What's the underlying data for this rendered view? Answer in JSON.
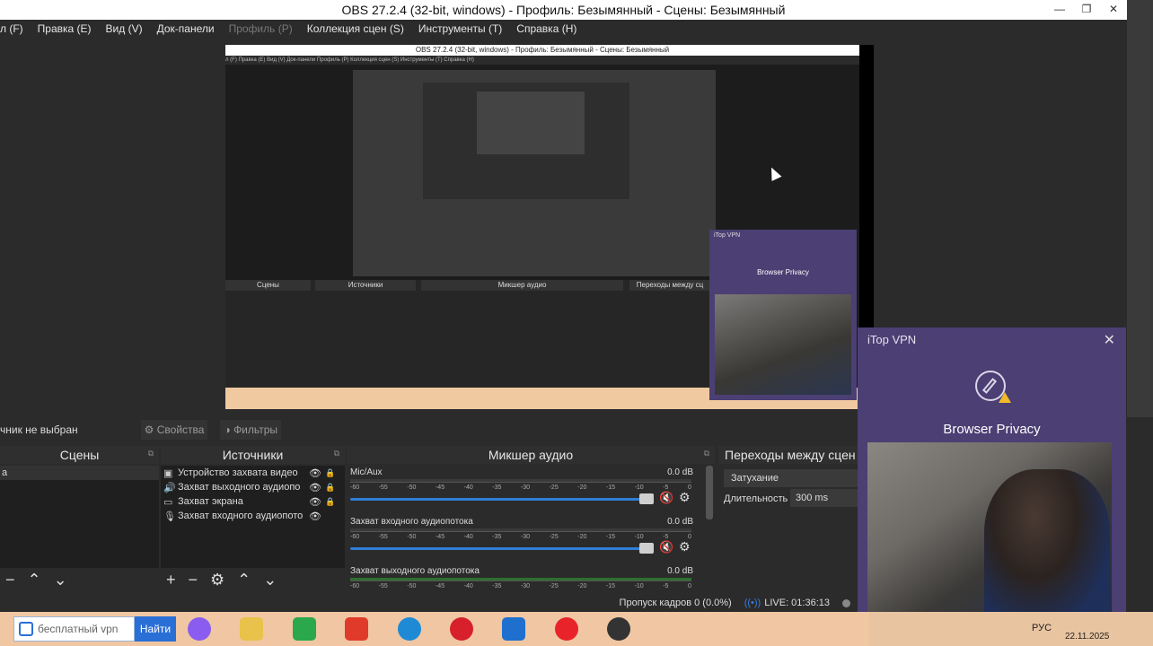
{
  "window": {
    "title": "OBS 27.2.4 (32-bit, windows) - Профиль: Безымянный - Сцены: Безымянный"
  },
  "menu": [
    {
      "label": "л (F)",
      "disabled": false
    },
    {
      "label": "Правка (E)",
      "disabled": false
    },
    {
      "label": "Вид (V)",
      "disabled": false
    },
    {
      "label": "Док-панели",
      "disabled": false
    },
    {
      "label": "Профиль (P)",
      "disabled": true
    },
    {
      "label": "Коллекция сцен (S)",
      "disabled": false
    },
    {
      "label": "Инструменты (T)",
      "disabled": false
    },
    {
      "label": "Справка (H)",
      "disabled": false
    }
  ],
  "preview_nested": {
    "title": "OBS 27.2.4 (32-bit, windows) - Профиль: Безымянный - Сцены: Безымянный",
    "menu": "л (F)  Правка (E)  Вид (V)  Док-панели  Профиль (P)  Коллекция сцен (S)  Инструменты (T)  Справка (H)",
    "dock_headers": [
      "Сцены",
      "Источники",
      "Микшер аудио",
      "Переходы между сц"
    ],
    "vpn_title": "iTop VPN",
    "vpn_name": "Browser Privacy"
  },
  "source_bar": {
    "label": "чник не выбран",
    "properties": "Свойства",
    "filters": "Фильтры"
  },
  "docks": {
    "scenes": {
      "title": "Сцены",
      "first_item": "а"
    },
    "sources": {
      "title": "Источники",
      "items": [
        {
          "icon": "camera-icon",
          "name": "Устройство захвата видео"
        },
        {
          "icon": "speaker-icon",
          "name": "Захват выходного аудиопо"
        },
        {
          "icon": "monitor-icon",
          "name": "Захват экрана"
        },
        {
          "icon": "microphone-icon",
          "name": "Захват входного аудиопото"
        }
      ]
    },
    "mixer": {
      "title": "Микшер аудио",
      "ticks": [
        "-60",
        "-55",
        "-50",
        "-45",
        "-40",
        "-35",
        "-30",
        "-25",
        "-20",
        "-15",
        "-10",
        "-5",
        "0"
      ],
      "channels": [
        {
          "name": "Mic/Aux",
          "db": "0.0 dB",
          "volume": 0.87
        },
        {
          "name": "Захват входного аудиопотока",
          "db": "0.0 dB",
          "volume": 0.87
        },
        {
          "name": "Захват выходного аудиопотока",
          "db": "0.0 dB",
          "volume": 0.87
        }
      ]
    },
    "transitions": {
      "title": "Переходы между сцен",
      "selected": "Затухание",
      "duration_label": "Длительность",
      "duration_value": "300 ms"
    }
  },
  "status": {
    "dropped": "Пропуск кадров 0 (0.0%)",
    "live": "LIVE: 01:36:13"
  },
  "vpn": {
    "title": "iTop VPN",
    "name": "Browser Privacy"
  },
  "taskbar": {
    "search_placeholder": "бесплатный vpn",
    "search_button": "Найти",
    "icons": [
      "alice-icon",
      "file-explorer-icon",
      "store-icon",
      "yandex-browser-icon",
      "edge-icon",
      "opera-icon",
      "shield-icon",
      "yandex-icon",
      "obs-icon"
    ],
    "lang": "РУС",
    "date": "22.11.2025"
  },
  "colors": {
    "accent": "#2a6fd6",
    "vpn_bg": "#4b3f74",
    "mute": "#dd2222"
  }
}
